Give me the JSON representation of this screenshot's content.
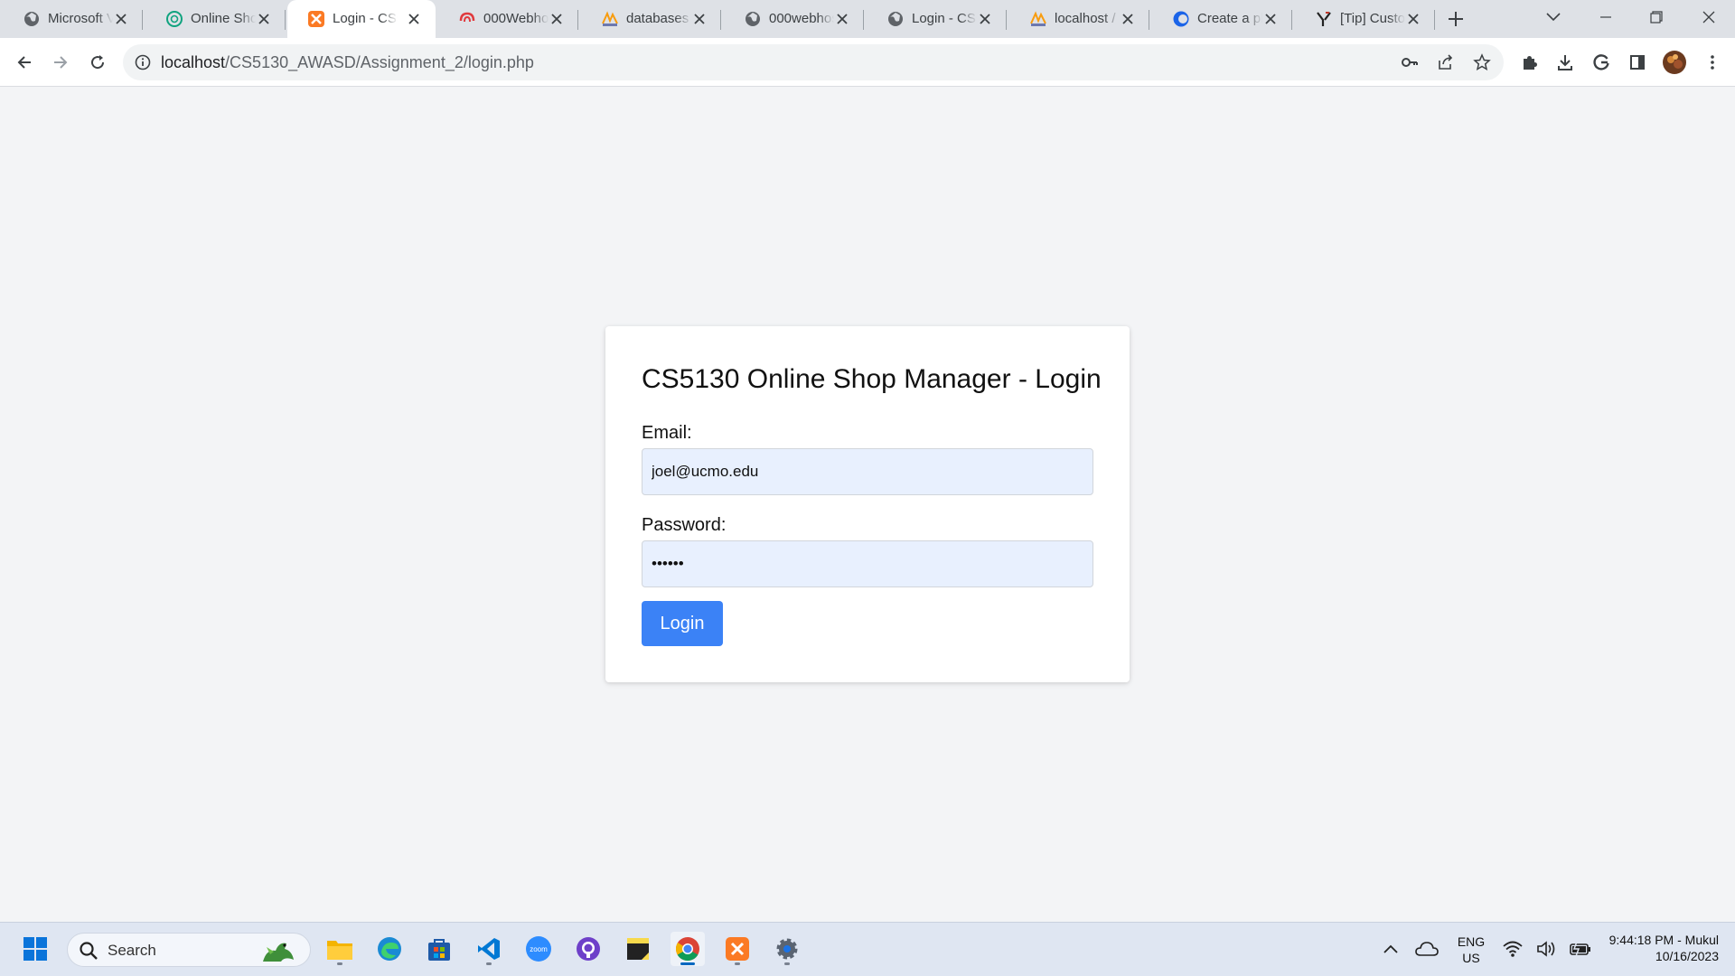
{
  "browser": {
    "tabs": [
      {
        "title": "Microsoft V",
        "icon": "globe-icon",
        "active": false
      },
      {
        "title": "Online Sho",
        "icon": "chatgpt-icon",
        "active": false
      },
      {
        "title": "Login - CS5",
        "icon": "xampp-icon",
        "active": true
      },
      {
        "title": "000Webho",
        "icon": "webhost-icon",
        "active": false
      },
      {
        "title": "databases",
        "icon": "phpmyadmin-icon",
        "active": false
      },
      {
        "title": "000webhos",
        "icon": "globe-icon",
        "active": false
      },
      {
        "title": "Login - CS5",
        "icon": "globe-icon",
        "active": false
      },
      {
        "title": "localhost /",
        "icon": "phpmyadmin-icon",
        "active": false
      },
      {
        "title": "Create a pl",
        "icon": "edge-bing-icon",
        "active": false
      },
      {
        "title": "[Tip] Custo",
        "icon": "tip-icon",
        "active": false
      }
    ],
    "address": {
      "host": "localhost",
      "path": "/CS5130_AWASD/Assignment_2/login.php"
    }
  },
  "page": {
    "title": "CS5130 Online Shop Manager - Login",
    "email_label": "Email:",
    "email_value": "joel@ucmo.edu",
    "password_label": "Password:",
    "password_value": "••••••",
    "login_label": "Login"
  },
  "taskbar": {
    "search_placeholder": "Search",
    "lang_top": "ENG",
    "lang_bottom": "US",
    "time": "9:44:18 PM - Mukul",
    "date": "10/16/2023"
  },
  "colors": {
    "accent": "#3b82f6",
    "input_bg": "#e8f0fe",
    "page_bg": "#f3f4f6",
    "tabstrip_bg": "#dee1e6"
  }
}
